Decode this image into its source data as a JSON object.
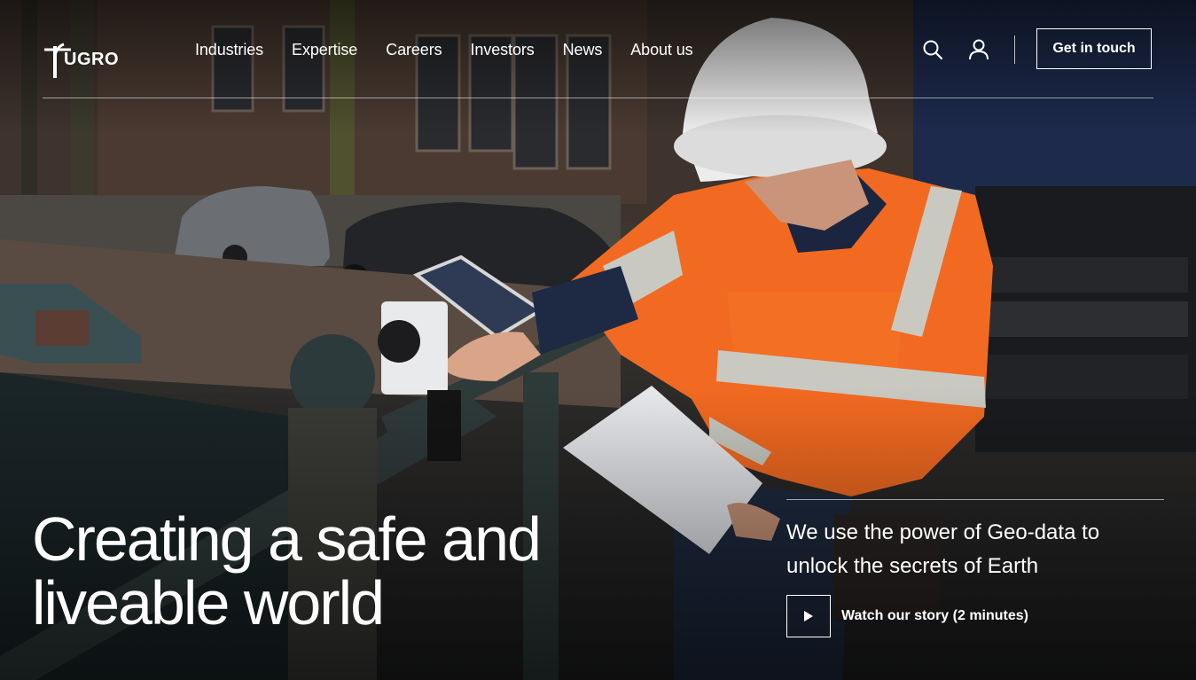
{
  "brand": {
    "logo_text": "FUGRO"
  },
  "nav": {
    "items": [
      {
        "label": "Industries"
      },
      {
        "label": "Expertise"
      },
      {
        "label": "Careers"
      },
      {
        "label": "Investors"
      },
      {
        "label": "News"
      },
      {
        "label": "About us"
      }
    ],
    "search_icon": "search-icon",
    "account_icon": "user-icon",
    "cta_label": "Get in touch"
  },
  "hero": {
    "headline_line1": "Creating a safe and",
    "headline_line2": "liveable world",
    "story_text": "We use the power of Geo-data to unlock the secrets of Earth",
    "watch_label": "Watch our story (2 minutes)",
    "play_icon": "play-icon"
  },
  "colors": {
    "text": "#ffffff",
    "safety_orange": "#f26a21",
    "reflective_stripe": "#c9c9c2"
  }
}
